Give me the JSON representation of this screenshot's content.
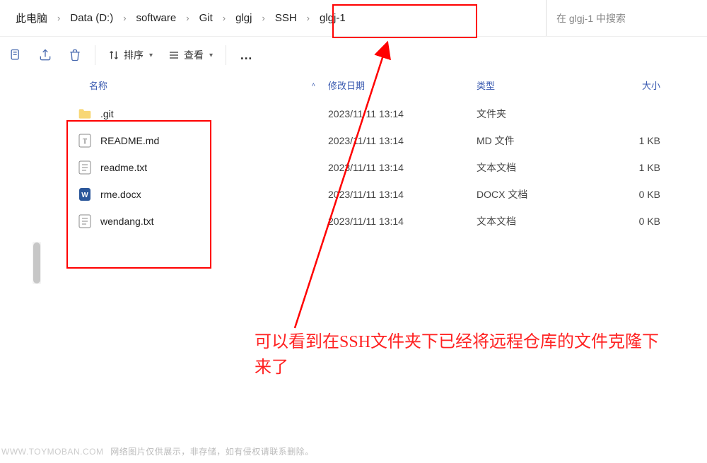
{
  "breadcrumb": {
    "items": [
      "此电脑",
      "Data (D:)",
      "software",
      "Git",
      "glgj",
      "SSH",
      "glgj-1"
    ]
  },
  "search": {
    "placeholder": "在 glgj-1 中搜索"
  },
  "toolbar": {
    "sort_label": "排序",
    "view_label": "查看",
    "more_label": "…"
  },
  "columns": {
    "name": "名称",
    "date": "修改日期",
    "type": "类型",
    "size": "大小"
  },
  "files": [
    {
      "icon": "folder",
      "name": ".git",
      "date": "2023/11/11 13:14",
      "type": "文件夹",
      "size": ""
    },
    {
      "icon": "md",
      "name": "README.md",
      "date": "2023/11/11 13:14",
      "type": "MD 文件",
      "size": "1 KB"
    },
    {
      "icon": "txt",
      "name": "readme.txt",
      "date": "2023/11/11 13:14",
      "type": "文本文档",
      "size": "1 KB"
    },
    {
      "icon": "docx",
      "name": "rme.docx",
      "date": "2023/11/11 13:14",
      "type": "DOCX 文档",
      "size": "0 KB"
    },
    {
      "icon": "txt",
      "name": "wendang.txt",
      "date": "2023/11/11 13:14",
      "type": "文本文档",
      "size": "0 KB"
    }
  ],
  "annot": {
    "text": "可以看到在SSH文件夹下已经将远程仓库的文件克隆下来了"
  },
  "watermark": {
    "brand": "www.toymoban.com",
    "text": "网络图片仅供展示，非存储，如有侵权请联系删除。"
  }
}
